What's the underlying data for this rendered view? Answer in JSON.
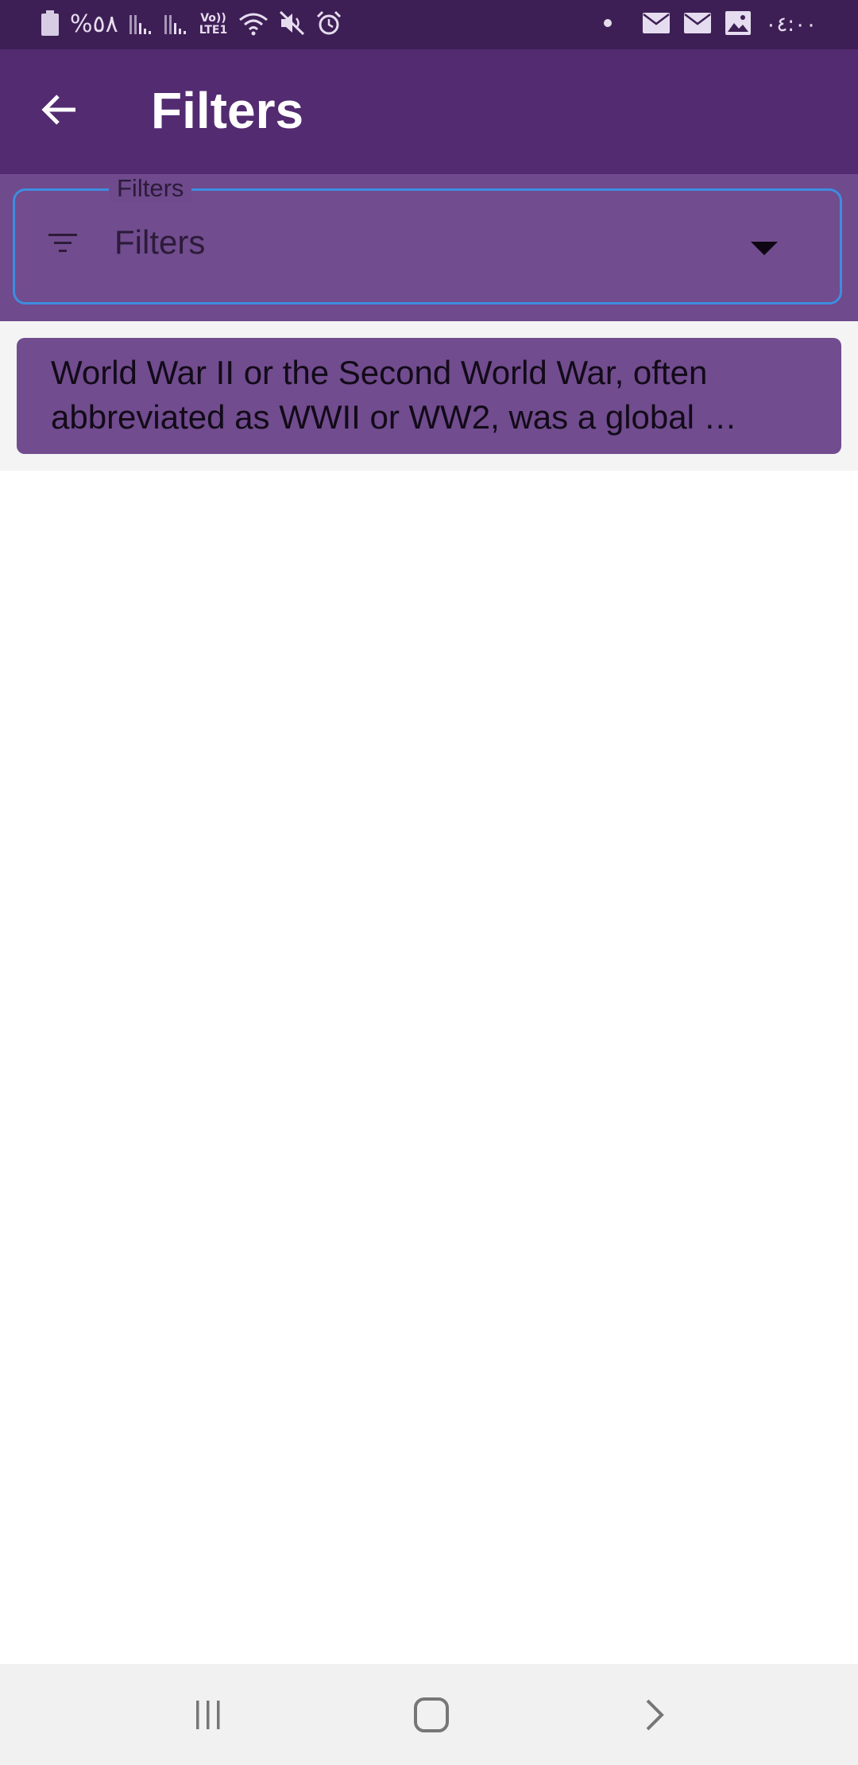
{
  "status_bar": {
    "battery_percent": "%٥٨",
    "network_label_top": "Vo))",
    "network_label_bottom": "LTE1",
    "time": "٠٤:٠٠",
    "icons": [
      "battery-icon",
      "signal-icon",
      "signal-icon",
      "wifi-icon",
      "mute-icon",
      "alarm-icon",
      "dot-icon",
      "email-icon",
      "email-icon",
      "image-icon"
    ]
  },
  "app_bar": {
    "title": "Filters",
    "back_icon": "arrow-left-icon",
    "background": "#532b71"
  },
  "filter": {
    "label": "Filters",
    "value": "Filters",
    "icon": "filter-list-icon",
    "dropdown_icon": "dropdown-arrow-icon",
    "border_color": "#3e8de0"
  },
  "list": {
    "items": [
      {
        "text": "World War II or the Second World War, often abbreviated as WWII or WW2, was a global …"
      }
    ]
  },
  "nav_bar": {
    "icons": [
      "recent-apps-icon",
      "home-icon",
      "back-chevron-icon"
    ]
  },
  "colors": {
    "status_bar": "#3d1f55",
    "accent": "#714c8e",
    "list_background": "#f4f4f4"
  }
}
